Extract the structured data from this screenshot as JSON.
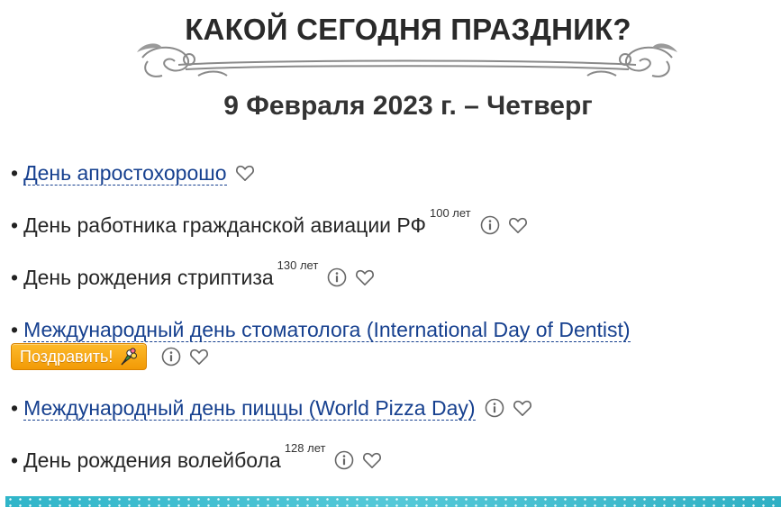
{
  "header": {
    "title": "КАКОЙ СЕГОДНЯ ПРАЗДНИК?",
    "date": "9 Февраля 2023 г. – Четверг"
  },
  "holidays": [
    {
      "bullet": "•",
      "label": "День апростохорошо",
      "years": "",
      "link": true,
      "info": false,
      "favorite": true
    },
    {
      "bullet": "•",
      "label": "День работника гражданской авиации РФ",
      "years": "100 лет",
      "link": false,
      "info": true,
      "favorite": true
    },
    {
      "bullet": "•",
      "label": "День рождения стриптиза",
      "years": "130 лет",
      "link": false,
      "info": true,
      "favorite": true
    },
    {
      "bullet": "•",
      "label": "Международный день стоматолога (International Day of Dentist)",
      "years": "",
      "link": true,
      "info": true,
      "favorite": true
    },
    {
      "bullet": "•",
      "label": "Международный день пиццы (World Pizza Day)",
      "years": "",
      "link": true,
      "info": true,
      "favorite": true
    },
    {
      "bullet": "•",
      "label": "День рождения волейбола",
      "years": "128 лет",
      "link": false,
      "info": true,
      "favorite": true
    }
  ],
  "actions": {
    "congratulate_label": "Поздравить!"
  },
  "icons": {
    "info": "info-icon",
    "favorite": "heart-outline-icon",
    "gift": "bouquet-icon",
    "ornament": "ornamental-divider"
  },
  "colors": {
    "link": "#16408f",
    "button": "#f4a10c",
    "footer": "#3bbccd"
  }
}
